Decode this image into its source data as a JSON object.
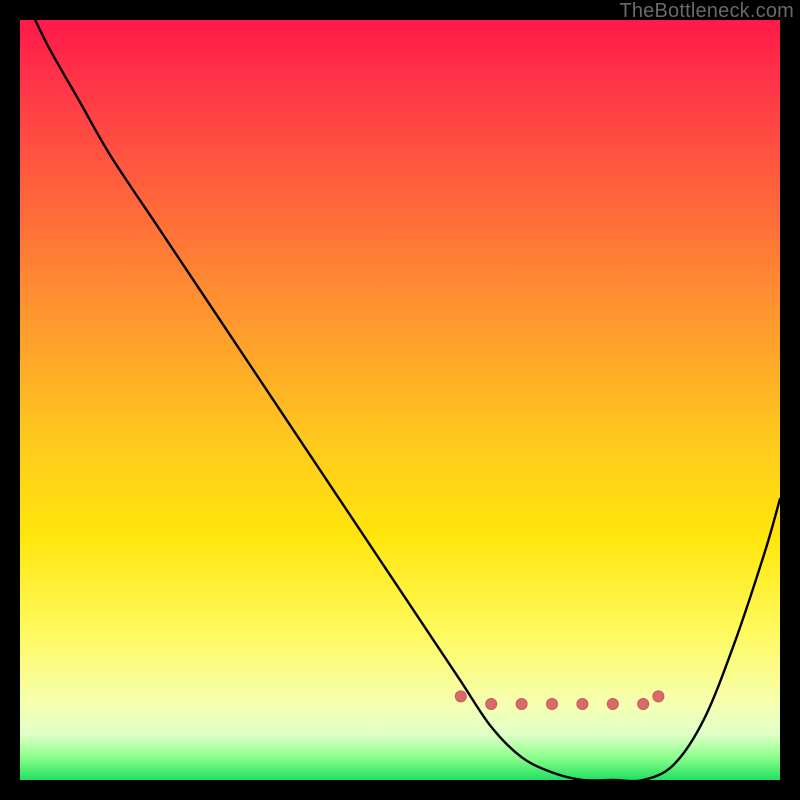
{
  "watermark": "TheBottleneck.com",
  "colors": {
    "curve_stroke": "#000000",
    "marker_fill": "#d86a6a",
    "marker_stroke": "#c95a5a"
  },
  "chart_data": {
    "type": "line",
    "title": "",
    "xlabel": "",
    "ylabel": "",
    "xlim": [
      0,
      100
    ],
    "ylim": [
      0,
      100
    ],
    "grid": false,
    "series": [
      {
        "name": "bottleneck-curve",
        "x": [
          2,
          4,
          8,
          12,
          18,
          24,
          30,
          36,
          42,
          48,
          54,
          58,
          62,
          66,
          70,
          74,
          78,
          82,
          86,
          90,
          94,
          98,
          100
        ],
        "values": [
          100,
          96,
          89,
          82,
          73,
          64,
          55,
          46,
          37,
          28,
          19,
          13,
          7,
          3,
          1,
          0,
          0,
          0,
          2,
          8,
          18,
          30,
          37
        ]
      }
    ],
    "markers": {
      "name": "valley-dots",
      "x": [
        58,
        62,
        66,
        70,
        74,
        78,
        82,
        84
      ],
      "values": [
        11,
        10,
        10,
        10,
        10,
        10,
        10,
        11
      ]
    }
  }
}
